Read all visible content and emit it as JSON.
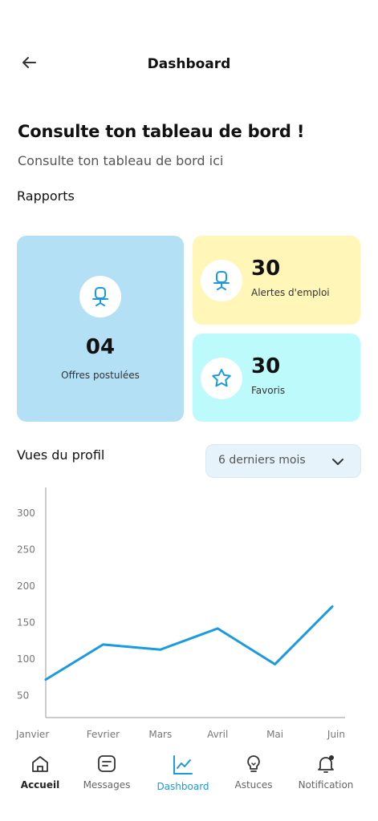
{
  "header": {
    "title": "Dashboard"
  },
  "page": {
    "heading": "Consulte ton tableau de bord !",
    "subheading": "Consulte ton tableau de bord ici",
    "reports_title": "Rapports"
  },
  "cards": {
    "applied": {
      "value": "04",
      "label": "Offres postulées",
      "color": "#b4e0f5",
      "icon": "chair-icon"
    },
    "alerts": {
      "value": "30",
      "label": "Alertes d'emploi",
      "color": "#fff6b8",
      "icon": "chair-icon"
    },
    "favorites": {
      "value": "30",
      "label": "Favoris",
      "color": "#bdfafb",
      "icon": "star-icon"
    }
  },
  "views": {
    "title": "Vues du profil",
    "period": "6 derniers mois"
  },
  "chart_data": {
    "type": "line",
    "categories": [
      "Janvier",
      "Fevrier",
      "Mars",
      "Avril",
      "Mai",
      "Juin"
    ],
    "values": [
      72,
      120,
      113,
      142,
      93,
      172
    ],
    "yticks": [
      50,
      100,
      150,
      200,
      250,
      300
    ],
    "ylim": [
      20,
      335
    ],
    "line_color": "#1a9ae0"
  },
  "nav": {
    "items": [
      {
        "label": "Accueil",
        "icon": "home-icon"
      },
      {
        "label": "Messages",
        "icon": "message-icon"
      },
      {
        "label": "Dashboard",
        "icon": "chart-icon",
        "active": true
      },
      {
        "label": "Astuces",
        "icon": "lightbulb-icon"
      },
      {
        "label": "Notification",
        "icon": "bell-icon"
      }
    ],
    "active_color": "#1a9ae0"
  }
}
